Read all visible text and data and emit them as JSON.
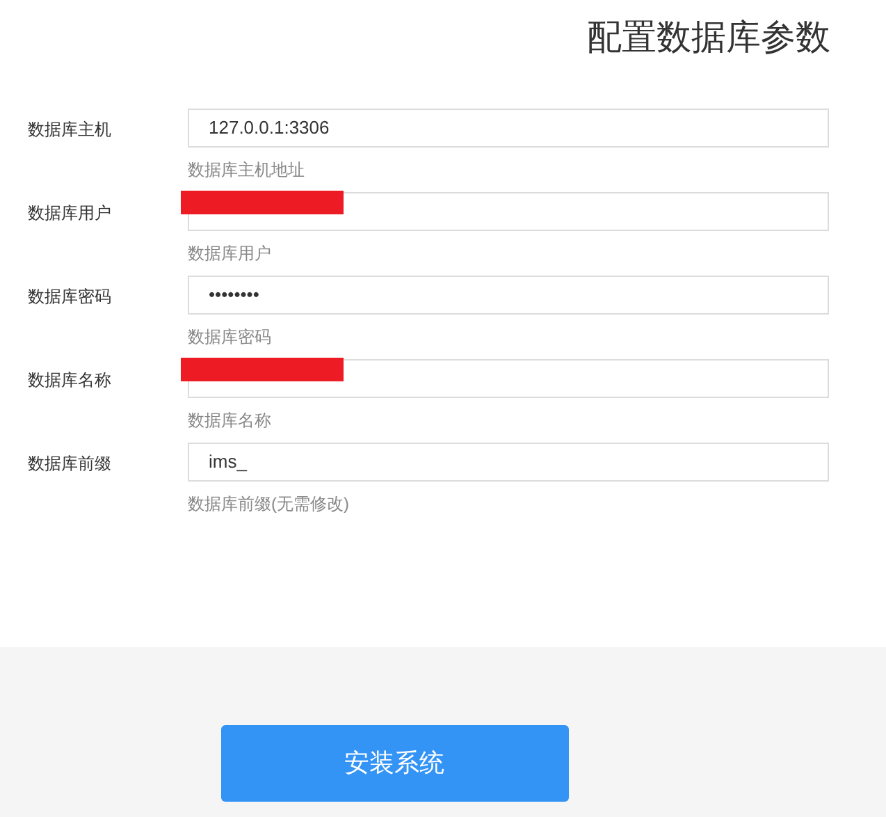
{
  "title": "配置数据库参数",
  "fields": [
    {
      "label": "数据库主机",
      "value": "127.0.0.1:3306",
      "hint": "数据库主机地址",
      "redacted": false
    },
    {
      "label": "数据库用户",
      "hint": "数据库用户",
      "redacted": true
    },
    {
      "label": "数据库密码",
      "value": "••••••••",
      "hint": "数据库密码",
      "redacted": false
    },
    {
      "label": "数据库名称",
      "hint": "数据库名称",
      "redacted": true
    },
    {
      "label": "数据库前缀",
      "value": "ims_",
      "hint": "数据库前缀(无需修改)",
      "redacted": false
    }
  ],
  "button": "安装系统"
}
